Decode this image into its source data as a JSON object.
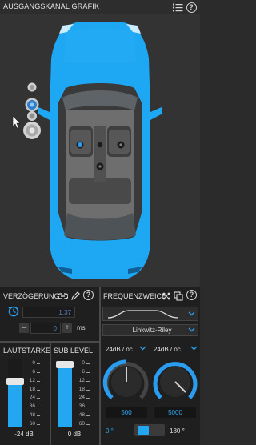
{
  "header": {
    "title": "AUSGANGSKANAL GRAFIK",
    "icons": [
      "list-icon",
      "help-icon"
    ]
  },
  "car": {
    "color": "#1ea7f2",
    "speakers": [
      "tweeter-small-top",
      "tweeter-selected",
      "mid-small",
      "woofer-large",
      "center-dash-speaker",
      "seat-speaker-front-center",
      "seat-speaker-front-right",
      "seat-speaker-rear-center"
    ]
  },
  "delay": {
    "title": "VERZÖGERUNG",
    "value": "1.37",
    "step_value": "0",
    "unit": "ms",
    "minus": "–",
    "plus": "+"
  },
  "crossover": {
    "title": "FREQUENZWEICH",
    "filter_type": "Linkwitz-Riley",
    "slope_low": "24dB / oc",
    "slope_high": "24dB / oc",
    "freq_low": "500",
    "freq_high": "5000"
  },
  "volume": {
    "title": "LAUTSTÄRKE",
    "value": "-24 dB",
    "scale": [
      "0",
      "6",
      "12",
      "18",
      "24",
      "36",
      "48",
      "60"
    ],
    "level": 0.68
  },
  "sublevel": {
    "title": "SUB LEVEL",
    "value": "0 dB",
    "scale": [
      "0",
      "6",
      "12",
      "18",
      "24",
      "36",
      "48",
      "60"
    ],
    "level": 0.92
  },
  "phase": {
    "left": "0 °",
    "right": "180 °"
  },
  "colors": {
    "accent": "#22a7f0",
    "panel": "#1f1f1f",
    "background": "#333333"
  }
}
